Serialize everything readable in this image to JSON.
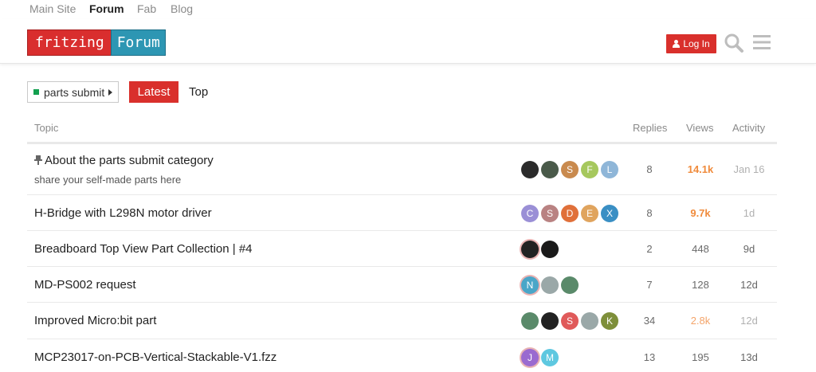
{
  "topnav": [
    "Main Site",
    "Forum",
    "Fab",
    "Blog"
  ],
  "logo": {
    "left": "fritzing",
    "right": "Forum"
  },
  "header": {
    "login_label": "Log In"
  },
  "filters": {
    "category": "parts submit",
    "tab_latest": "Latest",
    "tab_top": "Top"
  },
  "columns": {
    "topic": "Topic",
    "replies": "Replies",
    "views": "Views",
    "activity": "Activity"
  },
  "colors": {
    "accent": "#d9302c",
    "brand_blue": "#2d96b3",
    "category_green": "#12a04f",
    "hot_views": "#f08b3c"
  },
  "topics": [
    {
      "title": "About the parts submit category",
      "pinned": true,
      "excerpt": "share your self-made parts here",
      "posters": [
        {
          "letter": "",
          "color": "#2b2b2b",
          "icon": "photo-avatar"
        },
        {
          "letter": "",
          "color": "#4a5a4a",
          "icon": "photo-avatar"
        },
        {
          "letter": "S",
          "color": "#c98a4e"
        },
        {
          "letter": "F",
          "color": "#a6c85d"
        },
        {
          "letter": "L",
          "color": "#8fb6d8"
        }
      ],
      "replies": "8",
      "views": "14.1k",
      "activity": "Jan 16"
    },
    {
      "title": "H-Bridge with L298N motor driver",
      "pinned": false,
      "excerpt": "",
      "posters": [
        {
          "letter": "C",
          "color": "#9a8fd6"
        },
        {
          "letter": "S",
          "color": "#b98282"
        },
        {
          "letter": "D",
          "color": "#e0703a"
        },
        {
          "letter": "E",
          "color": "#e0a45e"
        },
        {
          "letter": "X",
          "color": "#3a8fc4"
        }
      ],
      "replies": "8",
      "views": "9.7k",
      "activity": "1d"
    },
    {
      "title": "Breadboard Top View Part Collection | #4",
      "pinned": false,
      "excerpt": "",
      "posters": [
        {
          "letter": "",
          "color": "#222222",
          "icon": "photo-avatar",
          "ring": true
        },
        {
          "letter": "",
          "color": "#1a1a1a",
          "icon": "photo-avatar"
        }
      ],
      "replies": "2",
      "views": "448",
      "activity": "9d"
    },
    {
      "title": "MD-PS002 request",
      "pinned": false,
      "excerpt": "",
      "posters": [
        {
          "letter": "N",
          "color": "#4aa6c8",
          "ring": true
        },
        {
          "letter": "",
          "color": "#9aa8a8",
          "icon": "photo-avatar"
        },
        {
          "letter": "",
          "color": "#5a8a6a",
          "icon": "photo-avatar"
        }
      ],
      "replies": "7",
      "views": "128",
      "activity": "12d"
    },
    {
      "title": "Improved Micro:bit part",
      "pinned": false,
      "excerpt": "",
      "posters": [
        {
          "letter": "",
          "color": "#5a8a6a",
          "icon": "photo-avatar"
        },
        {
          "letter": "",
          "color": "#222222",
          "icon": "photo-avatar"
        },
        {
          "letter": "S",
          "color": "#e05a5a"
        },
        {
          "letter": "",
          "color": "#9aa8a8",
          "icon": "photo-avatar"
        },
        {
          "letter": "K",
          "color": "#7e8f3a"
        }
      ],
      "replies": "34",
      "views": "2.8k",
      "activity": "12d"
    },
    {
      "title": "MCP23017-on-PCB-Vertical-Stackable-V1.fzz",
      "pinned": false,
      "excerpt": "",
      "posters": [
        {
          "letter": "J",
          "color": "#9a6ad0",
          "ring": true
        },
        {
          "letter": "M",
          "color": "#5ec8e0"
        }
      ],
      "replies": "13",
      "views": "195",
      "activity": "13d"
    }
  ]
}
